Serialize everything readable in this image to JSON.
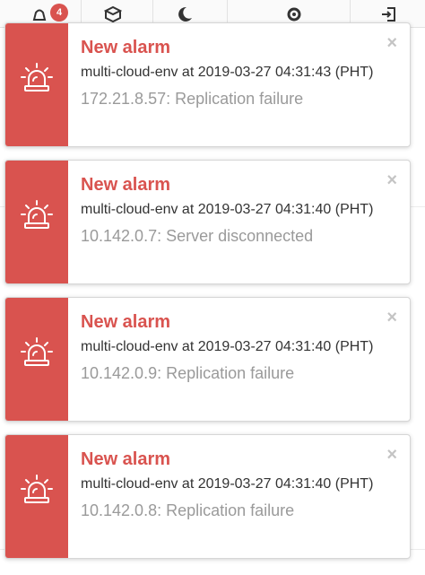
{
  "toolbar": {
    "alarm_badge_count": "4",
    "icons": [
      "alarm-icon",
      "cube-icon",
      "moon-icon",
      "gear-icon",
      "logout-icon"
    ]
  },
  "colors": {
    "alarm_red": "#d9534f",
    "message_gray": "#9a9a9a",
    "text_dark": "#333333"
  },
  "notifications": [
    {
      "title": "New alarm",
      "meta": "multi-cloud-env at 2019-03-27 04:31:43 (PHT)",
      "message": "172.21.8.57: Replication failure",
      "close": "×"
    },
    {
      "title": "New alarm",
      "meta": "multi-cloud-env at 2019-03-27 04:31:40 (PHT)",
      "message": "10.142.0.7: Server disconnected",
      "close": "×"
    },
    {
      "title": "New alarm",
      "meta": "multi-cloud-env at 2019-03-27 04:31:40 (PHT)",
      "message": "10.142.0.9: Replication failure",
      "close": "×"
    },
    {
      "title": "New alarm",
      "meta": "multi-cloud-env at 2019-03-27 04:31:40 (PHT)",
      "message": "10.142.0.8: Replication failure",
      "close": "×"
    }
  ]
}
